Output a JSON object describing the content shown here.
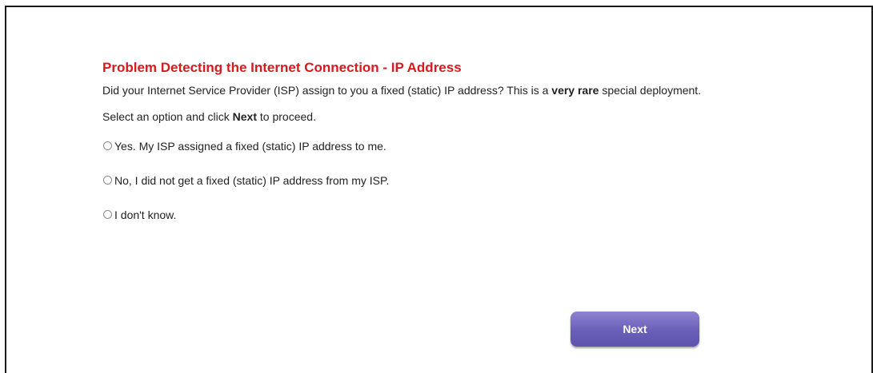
{
  "page": {
    "title": "Problem Detecting the Internet Connection - IP Address",
    "description_part1": "Did your Internet Service Provider (ISP) assign to you a fixed (static) IP address? This is a ",
    "description_bold": "very rare",
    "description_part2": " special deployment.",
    "instruction_part1": "Select an option and click ",
    "instruction_bold": "Next",
    "instruction_part2": " to proceed."
  },
  "options": [
    {
      "label": "Yes. My ISP assigned a fixed (static) IP address to me.",
      "selected": false
    },
    {
      "label": "No, I did not get a fixed (static) IP address from my ISP.",
      "selected": false
    },
    {
      "label": "I don't know.",
      "selected": false
    }
  ],
  "buttons": {
    "next_label": "Next"
  },
  "colors": {
    "title": "#d71920",
    "button": "#6a5fb8"
  }
}
